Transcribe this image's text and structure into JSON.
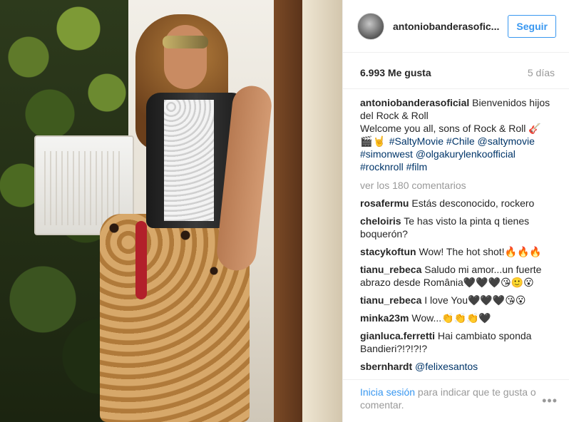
{
  "photo": {
    "alt": ""
  },
  "header": {
    "username": "antoniobanderasofic...",
    "follow_label": "Seguir"
  },
  "stats": {
    "likes": "6.993 Me gusta",
    "time": "5 días"
  },
  "caption": {
    "user": "antoniobanderasoficial",
    "line1": "Bienvenidos hijos del Rock & Roll",
    "line2": "Welcome you all, sons of Rock & Roll 🎸",
    "emoji": "🎬🤘",
    "tags": [
      "#SaltyMovie",
      "#Chile",
      "@saltymovie",
      "#simonwest",
      "@olgakurylenkoofficial",
      "#rocknroll",
      "#film"
    ]
  },
  "view_all": "ver los 180 comentarios",
  "comments": [
    {
      "user": "rosafermu",
      "text": "Estás desconocido, rockero"
    },
    {
      "user": "cheloiris",
      "text": "Te has visto la pinta q tienes boquerón?"
    },
    {
      "user": "stacykoftun",
      "text": "Wow! The hot shot!🔥🔥🔥"
    },
    {
      "user": "tianu_rebeca",
      "text": "Saludo mi amor...un fuerte abrazo desde România🖤🖤🖤😘🙂😮"
    },
    {
      "user": "tianu_rebeca",
      "text": "I love You🖤🖤🖤😘😮"
    },
    {
      "user": "minka23m",
      "text": "Wow...👏👏👏🖤"
    },
    {
      "user": "gianluca.ferretti",
      "text": "Hai cambiato sponda Bandieri?!?!?!?"
    },
    {
      "user": "sbernhardt",
      "text": "@felixesantos"
    }
  ],
  "footer": {
    "login_label": "Inicia sesión",
    "rest": " para indicar que te gusta o comentar.",
    "more_label": "•••"
  }
}
